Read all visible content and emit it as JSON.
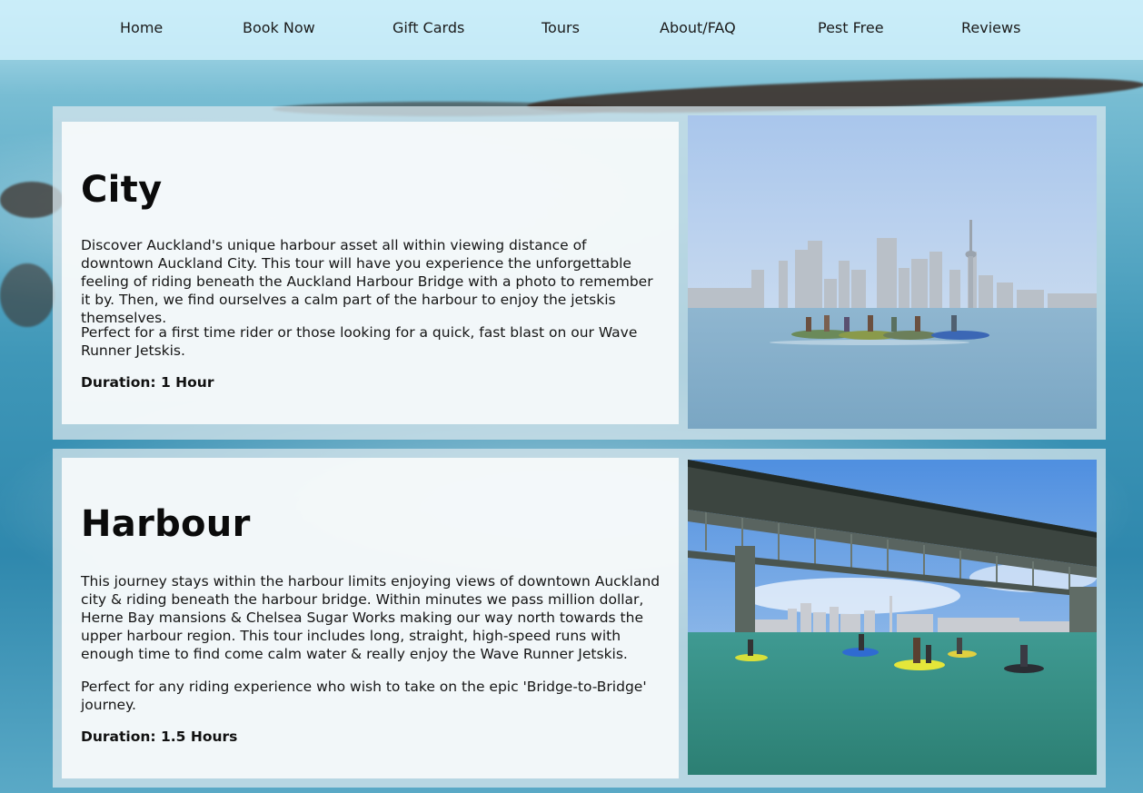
{
  "nav": {
    "items": [
      {
        "label": "Home"
      },
      {
        "label": "Book Now"
      },
      {
        "label": "Gift Cards"
      },
      {
        "label": "Tours"
      },
      {
        "label": "About/FAQ"
      },
      {
        "label": "Pest Free"
      },
      {
        "label": "Reviews"
      }
    ]
  },
  "tours": [
    {
      "title": "City",
      "paragraphs": [
        "Discover Auckland's unique harbour asset all within viewing distance of downtown Auckland City. This tour will have you experience the unforgettable feeling of riding beneath the Auckland Harbour Bridge with a photo to remember it by. Then, we find ourselves a calm part of the harbour to enjoy the jetskis themselves.",
        "Perfect for a first time rider or those looking for a quick, fast blast on our Wave Runner Jetskis."
      ],
      "duration": "Duration: 1 Hour"
    },
    {
      "title": "Harbour",
      "paragraphs": [
        "This journey stays within the harbour limits enjoying views of downtown Auckland city & riding beneath the harbour bridge. Within minutes we pass million dollar, Herne Bay mansions & Chelsea Sugar Works making our way north towards the upper harbour region. This tour includes long, straight, high-speed runs with enough time to find come calm water & really enjoy the Wave Runner Jetskis.",
        "Perfect for any riding experience who wish to take on the epic 'Bridge-to-Bridge' journey."
      ],
      "duration": "Duration: 1.5 Hours"
    }
  ],
  "colors": {
    "nav_bg": "#cdeefa",
    "text": "#151515",
    "water": "#3f97b8"
  }
}
